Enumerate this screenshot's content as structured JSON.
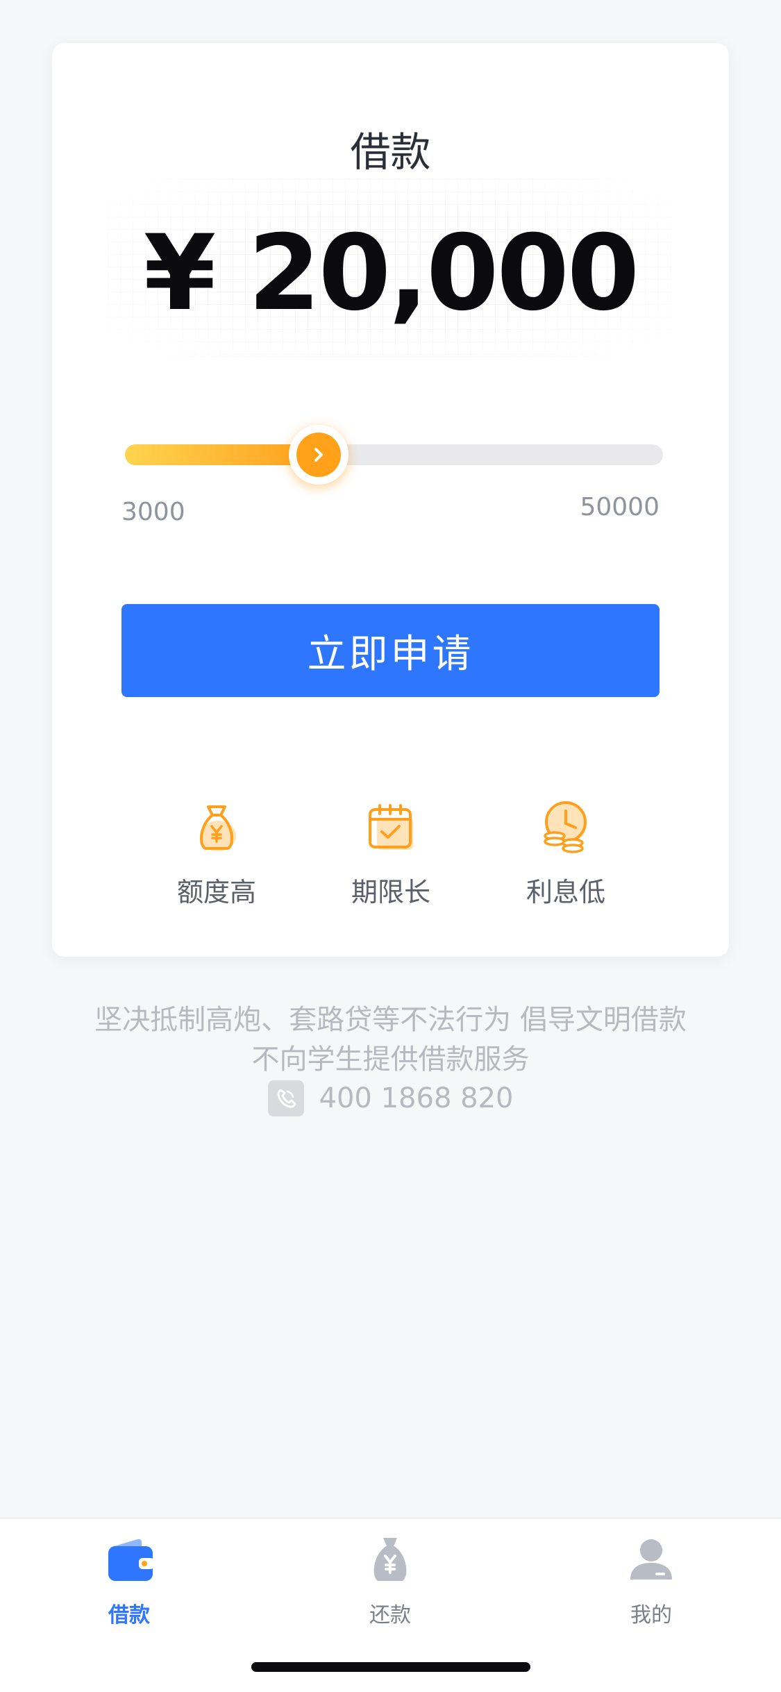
{
  "card": {
    "title": "借款",
    "amount": "¥ 20,000",
    "slider": {
      "min_label": "3000",
      "max_label": "50000",
      "progress": 0.36
    },
    "apply_label": "立即申请",
    "features": [
      {
        "icon": "money-bag-icon",
        "label": "额度高"
      },
      {
        "icon": "calendar-icon",
        "label": "期限长"
      },
      {
        "icon": "clock-coins-icon",
        "label": "利息低"
      }
    ]
  },
  "notice": {
    "line1": "坚决抵制高炮、套路贷等不法行为 倡导文明借款",
    "line2": "不向学生提供借款服务",
    "phone": "400 1868 820"
  },
  "tabbar": {
    "tabs": [
      {
        "label": "借款",
        "icon": "wallet-icon",
        "active": true
      },
      {
        "label": "还款",
        "icon": "money-bag-icon",
        "active": false
      },
      {
        "label": "我的",
        "icon": "user-icon",
        "active": false
      }
    ]
  },
  "colors": {
    "accent": "#2f76ff",
    "slider_start": "#ffd44f",
    "slider_end": "#ff9f1c"
  }
}
